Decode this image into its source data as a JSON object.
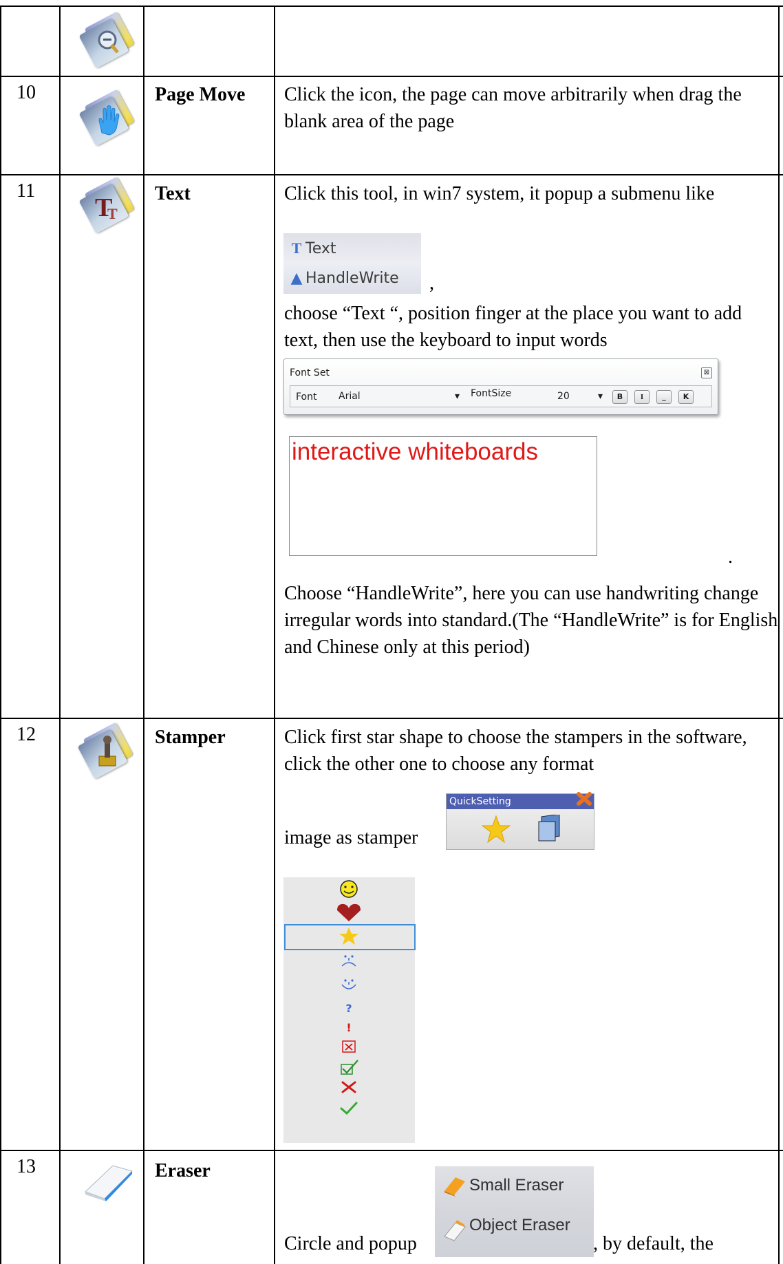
{
  "rows": [
    {
      "number": "",
      "icon": "zoom-icon",
      "name": "",
      "description": ""
    },
    {
      "number": "10",
      "icon": "hand-icon",
      "name": "Page Move",
      "description": "Click the icon, the page can move arbitrarily when drag the blank area of the page"
    },
    {
      "number": "11",
      "icon": "text-tool-icon",
      "name": "Text",
      "description_intro": "Click this tool, in win7 system, it popup a submenu like",
      "submenu": [
        "Text",
        "HandleWrite"
      ],
      "after_menu_punct": ",",
      "description_text": "choose “Text “, position finger at the place you want to add text, then use the keyboard to input words",
      "font_dialog": {
        "title": "Font Set",
        "font_label": "Font",
        "font_value": "Arial",
        "size_label": "FontSize",
        "size_value": "20",
        "buttons": [
          "B",
          "I",
          "_",
          "K"
        ]
      },
      "sample_text": "interactive whiteboards",
      "after_sample_punct": ".",
      "description_handwrite": "Choose “HandleWrite”, here you can use handwriting change irregular words into standard.(The “HandleWrite” is for English and Chinese only at this period)"
    },
    {
      "number": "12",
      "icon": "stamper-icon",
      "name": "Stamper",
      "description": "Click first star shape to choose the stampers in the software, click the other one to choose any format",
      "description_tail": "image as stamper",
      "quick_setting_title": "QuickSetting",
      "stamps": [
        "smiley",
        "heart",
        "star",
        "sad-face",
        "happy-face",
        "question",
        "exclamation",
        "boxed-x",
        "boxed-check",
        "cross",
        "check"
      ]
    },
    {
      "number": "13",
      "icon": "eraser-icon",
      "name": "Eraser",
      "description_prefix": "Circle and popup",
      "eraser_menu": [
        "Small Eraser",
        "Object Eraser"
      ],
      "description_suffix": ", by default, the"
    }
  ],
  "colors": {
    "grid": "#000000",
    "sample_text": "#e01818",
    "quick_title": "#4f5fb0",
    "selection": "#3f8fd8"
  }
}
